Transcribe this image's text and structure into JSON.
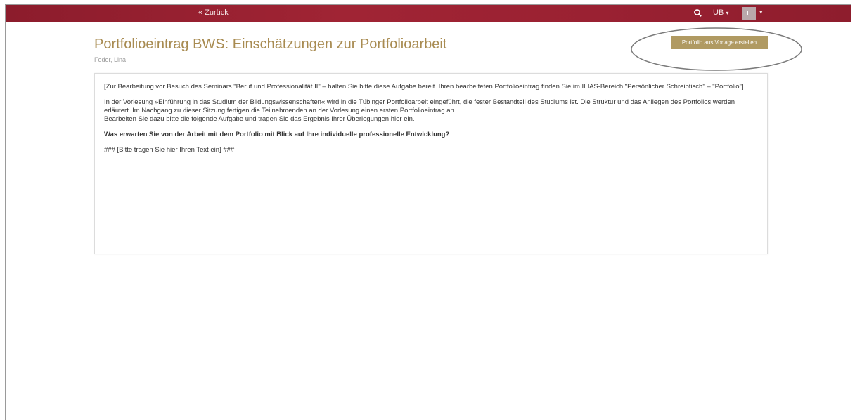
{
  "topbar": {
    "back_label": "« Zurück",
    "ub_label": "UB",
    "ub_caret": "▾",
    "user_initial": "L",
    "user_caret": "▾",
    "search_icon": "search-icon",
    "color": "#9a2132"
  },
  "header": {
    "title": "Portfolioeintrag BWS: Einschätzungen zur Portfolioarbeit",
    "author": "Feder, Lina",
    "create_button_label": "Portfolio aus Vorlage erstellen",
    "title_color": "#a88b51",
    "button_color": "#b09a62"
  },
  "content": {
    "intro": "[Zur Bearbeitung vor Besuch des Seminars \"Beruf und Professionalität II\" – halten Sie bitte diese Aufgabe bereit. Ihren bearbeiteten Portfolioeintrag finden Sie im ILIAS-Bereich \"Persönlicher Schreibtisch\" – \"Portfolio\"]",
    "paragraph_line1": "In der Vorlesung »Einführung in das Studium der Bildungswissenschaften« wird in die Tübinger Portfolioarbeit eingeführt, die fester Bestandteil des Studiums ist. Die Struktur und das Anliegen des Portfolios werden erläutert. Im Nachgang zu dieser Sitzung fertigen die Teilnehmenden an der Vorlesung einen ersten Portfolioeintrag an.",
    "paragraph_line2": "Bearbeiten Sie dazu bitte die folgende Aufgabe und tragen Sie das Ergebnis Ihrer Überlegungen hier ein.",
    "question": "Was erwarten Sie von der Arbeit mit dem Portfolio mit Blick auf Ihre individuelle professionelle Entwicklung?",
    "placeholder_text": "### [Bitte tragen Sie hier Ihren Text ein] ###"
  }
}
